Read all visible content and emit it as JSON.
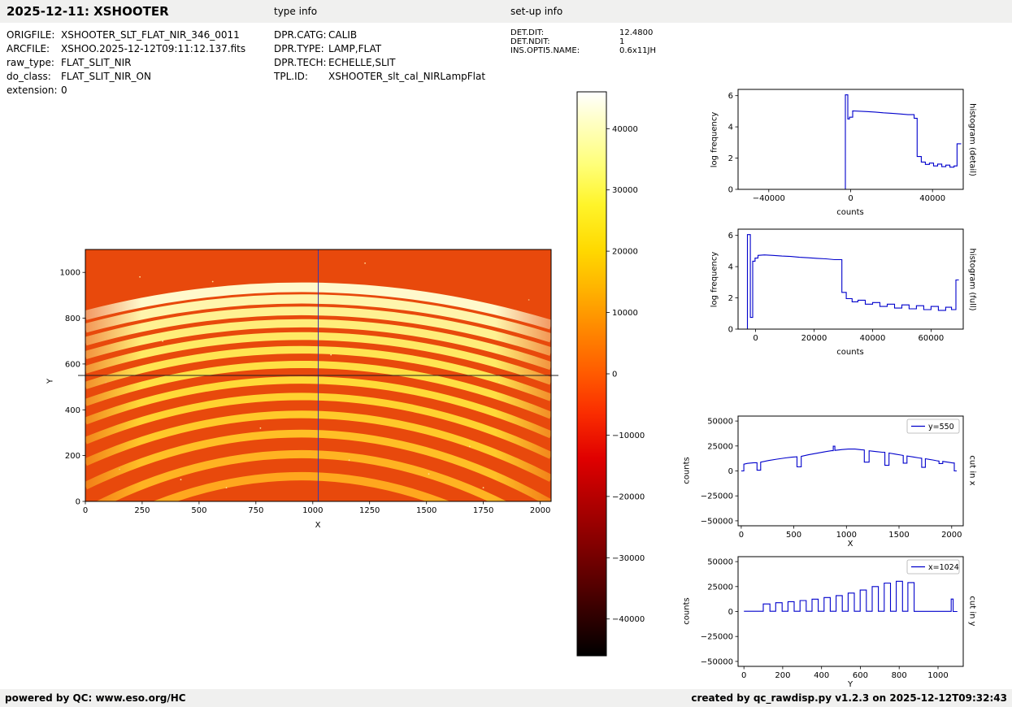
{
  "accent_blue": "#0000cc",
  "header": {
    "title": "2025-12-11: XSHOOTER",
    "type_info_label": "type info",
    "setup_info_label": "set-up info"
  },
  "metadata": {
    "left": [
      {
        "label": "ORIGFILE:",
        "value": "XSHOOTER_SLT_FLAT_NIR_346_0011"
      },
      {
        "label": "ARCFILE:",
        "value": "XSHOO.2025-12-12T09:11:12.137.fits"
      },
      {
        "label": "raw_type:",
        "value": "FLAT_SLIT_NIR"
      },
      {
        "label": "do_class:",
        "value": "FLAT_SLIT_NIR_ON"
      },
      {
        "label": "extension:",
        "value": "0"
      }
    ],
    "type_info": [
      {
        "label": "DPR.CATG:",
        "value": "CALIB"
      },
      {
        "label": "DPR.TYPE:",
        "value": "LAMP,FLAT"
      },
      {
        "label": "DPR.TECH:",
        "value": "ECHELLE,SLIT"
      },
      {
        "label": "TPL.ID:",
        "value": "XSHOOTER_slt_cal_NIRLampFlat"
      }
    ],
    "setup_info": [
      {
        "label": "DET.DIT:",
        "value": "12.4800"
      },
      {
        "label": "DET.NDIT:",
        "value": "1"
      },
      {
        "label": "INS.OPTI5.NAME:",
        "value": "0.6x11JH"
      }
    ]
  },
  "footer": {
    "left": "powered by QC: www.eso.org/HC",
    "right": "created by qc_rawdisp.py v1.2.3 on 2025-12-12T09:32:43"
  },
  "chart_data": [
    {
      "type": "heatmap",
      "description": "Raw NIR echelle lamp-flat frame: curved spectral orders, brightest band near top centre, hot colormap, crosshair at x=1024 / y=550",
      "xlabel": "X",
      "ylabel": "Y",
      "xlim": [
        0,
        2048
      ],
      "ylim": [
        0,
        1100
      ],
      "xticks": [
        0,
        250,
        500,
        750,
        1000,
        1250,
        1500,
        1750,
        2000
      ],
      "yticks": [
        0,
        200,
        400,
        600,
        800,
        1000
      ],
      "bg_color": "#e8490c",
      "crosshair": {
        "x": 1024,
        "y": 550
      },
      "crosshair_color_v": "#3a3aad",
      "crosshair_color_h": "#202020",
      "orders": [
        {
          "apex": 935,
          "drop": 150,
          "w": 42,
          "c": "#fff9cc"
        },
        {
          "apex": 884,
          "drop": 156,
          "w": 40,
          "c": "#fff5ac"
        },
        {
          "apex": 832,
          "drop": 163,
          "w": 38,
          "c": "#fff192"
        },
        {
          "apex": 778,
          "drop": 171,
          "w": 36,
          "c": "#ffed7a"
        },
        {
          "apex": 722,
          "drop": 180,
          "w": 34,
          "c": "#ffe964"
        },
        {
          "apex": 662,
          "drop": 191,
          "w": 33,
          "c": "#ffe452"
        },
        {
          "apex": 598,
          "drop": 204,
          "w": 32,
          "c": "#ffdf44"
        },
        {
          "apex": 530,
          "drop": 219,
          "w": 32,
          "c": "#ffd938"
        },
        {
          "apex": 458,
          "drop": 236,
          "w": 32,
          "c": "#ffd230"
        },
        {
          "apex": 380,
          "drop": 256,
          "w": 33,
          "c": "#ffc92a"
        },
        {
          "apex": 296,
          "drop": 279,
          "w": 34,
          "c": "#ffbf26"
        },
        {
          "apex": 206,
          "drop": 305,
          "w": 35,
          "c": "#ffb322"
        },
        {
          "apex": 110,
          "drop": 334,
          "w": 36,
          "c": "#ffa71e"
        }
      ],
      "speckles": [
        [
          150,
          140
        ],
        [
          420,
          95
        ],
        [
          1160,
          180
        ],
        [
          1690,
          240
        ],
        [
          340,
          700
        ],
        [
          1820,
          520
        ],
        [
          560,
          960
        ],
        [
          1230,
          1040
        ],
        [
          1950,
          880
        ],
        [
          90,
          520
        ],
        [
          770,
          320
        ],
        [
          1510,
          120
        ],
        [
          240,
          980
        ],
        [
          1080,
          640
        ],
        [
          1750,
          60
        ],
        [
          620,
          60
        ]
      ]
    },
    {
      "type": "colorbar",
      "range": [
        -46000,
        46000
      ],
      "ticks": [
        40000,
        30000,
        20000,
        10000,
        0,
        -10000,
        -20000,
        -30000,
        -40000
      ],
      "gradient": [
        [
          0,
          "#ffffff"
        ],
        [
          0.05,
          "#ffffc8"
        ],
        [
          0.13,
          "#ffff78"
        ],
        [
          0.2,
          "#fff42a"
        ],
        [
          0.28,
          "#ffd900"
        ],
        [
          0.35,
          "#ffb300"
        ],
        [
          0.42,
          "#ff8900"
        ],
        [
          0.5,
          "#ff5a00"
        ],
        [
          0.57,
          "#fa2d00"
        ],
        [
          0.65,
          "#e00000"
        ],
        [
          0.72,
          "#b50000"
        ],
        [
          0.8,
          "#850000"
        ],
        [
          0.88,
          "#520000"
        ],
        [
          0.95,
          "#220000"
        ],
        [
          1,
          "#000000"
        ]
      ]
    },
    {
      "type": "line",
      "right_label": "histogram (detail)",
      "xlabel": "counts",
      "ylabel": "log frequency",
      "xlim": [
        -55000,
        55000
      ],
      "ylim": [
        0,
        6.4
      ],
      "xticks": [
        -40000,
        0,
        40000
      ],
      "yticks": [
        0,
        2,
        4,
        6
      ],
      "grid": false,
      "x": [
        -55000,
        -2600,
        -2600,
        -1400,
        -1400,
        -600,
        -600,
        1000,
        1000,
        8000,
        12000,
        16000,
        20000,
        24000,
        28000,
        31000,
        31000,
        32500,
        32500,
        34500,
        34500,
        36500,
        36500,
        38500,
        38500,
        40500,
        40500,
        42500,
        42500,
        44500,
        44500,
        46500,
        46500,
        48500,
        48500,
        50500,
        50500,
        52000,
        52000,
        54000
      ],
      "y": [
        0,
        0,
        6.05,
        6.05,
        4.5,
        4.5,
        4.62,
        4.62,
        5.02,
        4.98,
        4.95,
        4.9,
        4.87,
        4.83,
        4.78,
        4.78,
        4.55,
        4.55,
        2.1,
        2.1,
        1.75,
        1.75,
        1.6,
        1.6,
        1.68,
        1.68,
        1.5,
        1.5,
        1.62,
        1.62,
        1.45,
        1.45,
        1.55,
        1.55,
        1.42,
        1.42,
        1.5,
        1.5,
        2.92,
        2.92
      ]
    },
    {
      "type": "line",
      "right_label": "histogram (full)",
      "xlabel": "counts",
      "ylabel": "log frequency",
      "xlim": [
        -6000,
        71000
      ],
      "ylim": [
        0,
        6.4
      ],
      "xticks": [
        0,
        20000,
        40000,
        60000
      ],
      "yticks": [
        0,
        2,
        4,
        6
      ],
      "grid": false,
      "x": [
        -5500,
        -2800,
        -2800,
        -1800,
        -1800,
        -1000,
        -1000,
        -200,
        -200,
        800,
        800,
        3000,
        6000,
        9000,
        12000,
        15000,
        18000,
        21000,
        24000,
        27000,
        29500,
        29500,
        31000,
        31000,
        33000,
        33000,
        35000,
        35000,
        37500,
        37500,
        40000,
        40000,
        42500,
        42500,
        45000,
        45000,
        47500,
        47500,
        50000,
        50000,
        52500,
        52500,
        55000,
        55000,
        57500,
        57500,
        60000,
        60000,
        62500,
        62500,
        65000,
        65000,
        67000,
        67000,
        68500,
        68500,
        69500
      ],
      "y": [
        0,
        0,
        6.05,
        6.05,
        0.75,
        0.75,
        4.35,
        4.35,
        4.55,
        4.55,
        4.72,
        4.75,
        4.72,
        4.68,
        4.65,
        4.6,
        4.57,
        4.53,
        4.5,
        4.45,
        4.45,
        2.35,
        2.35,
        1.95,
        1.95,
        1.75,
        1.75,
        1.85,
        1.85,
        1.6,
        1.6,
        1.7,
        1.7,
        1.45,
        1.45,
        1.6,
        1.6,
        1.35,
        1.35,
        1.55,
        1.55,
        1.3,
        1.3,
        1.5,
        1.5,
        1.25,
        1.25,
        1.45,
        1.45,
        1.2,
        1.2,
        1.4,
        1.4,
        1.25,
        1.25,
        3.15,
        3.15
      ]
    },
    {
      "type": "line",
      "right_label": "cut in x",
      "legend": "y=550",
      "legend_pos": "upper-right",
      "xlabel": "X",
      "ylabel": "counts",
      "xlim": [
        -30,
        2110
      ],
      "ylim": [
        -55000,
        55000
      ],
      "xticks": [
        0,
        500,
        1000,
        1500,
        2000
      ],
      "yticks": [
        -50000,
        -25000,
        0,
        25000,
        50000
      ],
      "grid": false,
      "x": [
        0,
        25,
        25,
        60,
        120,
        150,
        150,
        185,
        185,
        260,
        340,
        420,
        480,
        530,
        530,
        570,
        570,
        640,
        720,
        800,
        860,
        875,
        875,
        890,
        890,
        960,
        1020,
        1080,
        1140,
        1170,
        1170,
        1215,
        1215,
        1290,
        1340,
        1365,
        1365,
        1405,
        1405,
        1470,
        1520,
        1540,
        1540,
        1575,
        1575,
        1640,
        1690,
        1715,
        1715,
        1750,
        1750,
        1820,
        1860,
        1880,
        1880,
        1915,
        1915,
        1975,
        2010,
        2025,
        2025,
        2048
      ],
      "y": [
        0,
        0,
        6800,
        7600,
        8200,
        8200,
        700,
        700,
        8800,
        10400,
        11800,
        13000,
        13800,
        14200,
        4100,
        4100,
        14600,
        16200,
        17800,
        19300,
        20300,
        20300,
        24800,
        24800,
        20600,
        21400,
        21900,
        21900,
        21300,
        21000,
        8800,
        8800,
        20200,
        19300,
        18700,
        18700,
        5600,
        5600,
        17900,
        16800,
        15900,
        15500,
        7800,
        7800,
        15000,
        13900,
        13000,
        12700,
        3600,
        3600,
        12200,
        11000,
        10200,
        9900,
        7400,
        7400,
        9500,
        8600,
        8000,
        8000,
        0,
        0
      ]
    },
    {
      "type": "line",
      "right_label": "cut in y",
      "legend": "x=1024",
      "legend_pos": "upper-right",
      "xlabel": "Y",
      "ylabel": "counts",
      "xlim": [
        -30,
        1130
      ],
      "ylim": [
        -55000,
        55000
      ],
      "xticks": [
        0,
        200,
        400,
        600,
        800,
        1000
      ],
      "yticks": [
        -50000,
        -25000,
        0,
        25000,
        50000
      ],
      "grid": false,
      "x": [
        0,
        100,
        100,
        134,
        134,
        164,
        164,
        197,
        197,
        227,
        227,
        259,
        259,
        289,
        289,
        321,
        321,
        351,
        351,
        383,
        383,
        413,
        413,
        445,
        445,
        475,
        475,
        507,
        507,
        537,
        537,
        569,
        569,
        599,
        599,
        631,
        631,
        661,
        661,
        693,
        693,
        723,
        723,
        755,
        755,
        785,
        785,
        817,
        817,
        845,
        845,
        877,
        877,
        1068,
        1068,
        1078,
        1078,
        1100
      ],
      "y": [
        250,
        250,
        7600,
        7600,
        250,
        250,
        8800,
        8800,
        250,
        250,
        9900,
        9900,
        250,
        250,
        11000,
        11000,
        250,
        250,
        12400,
        12400,
        250,
        250,
        14000,
        14000,
        250,
        250,
        16000,
        16000,
        250,
        250,
        18500,
        18500,
        250,
        250,
        21500,
        21500,
        250,
        250,
        25000,
        25000,
        250,
        250,
        28500,
        28500,
        250,
        250,
        30300,
        30300,
        250,
        250,
        29000,
        29000,
        150,
        150,
        12500,
        12500,
        0,
        0
      ]
    }
  ]
}
